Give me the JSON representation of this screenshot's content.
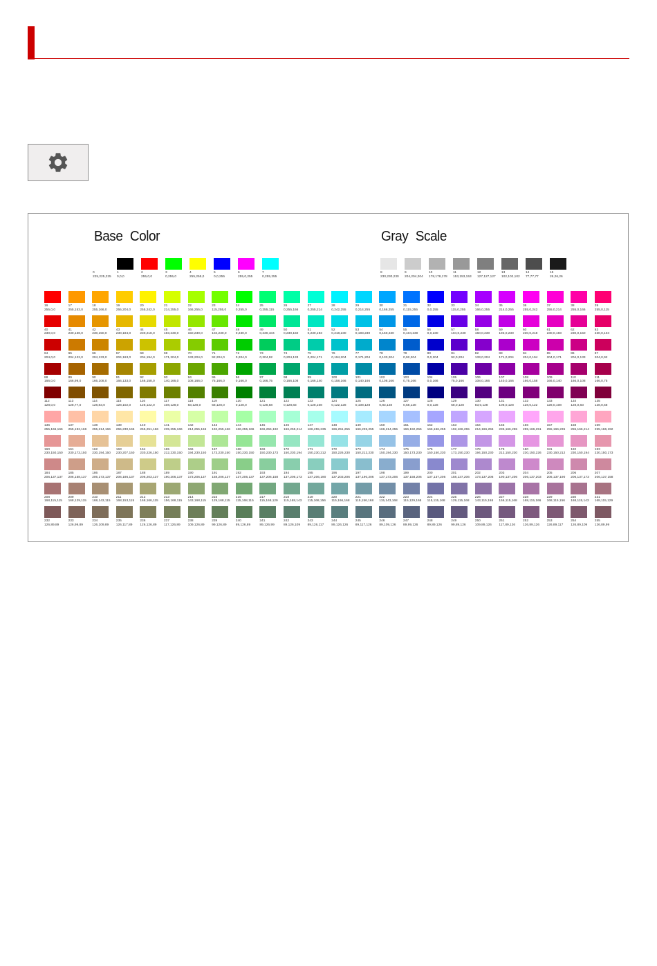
{
  "palette": {
    "base_title": "Base Color",
    "gray_title": "Gray Scale",
    "base": [
      {
        "i": 0,
        "rgb": "225,225,225"
      },
      {
        "i": 1,
        "rgb": "0,0,0"
      },
      {
        "i": 2,
        "rgb": "255,0,0"
      },
      {
        "i": 3,
        "rgb": "0,255,0"
      },
      {
        "i": 4,
        "rgb": "255,255,0"
      },
      {
        "i": 5,
        "rgb": "0,0,255"
      },
      {
        "i": 6,
        "rgb": "255,0,255"
      },
      {
        "i": 7,
        "rgb": "0,255,255"
      }
    ],
    "gray": [
      {
        "i": 8,
        "rgb": "230,230,230"
      },
      {
        "i": 9,
        "rgb": "204,204,204"
      },
      {
        "i": 10,
        "rgb": "178,178,178"
      },
      {
        "i": 11,
        "rgb": "153,153,153"
      },
      {
        "i": 12,
        "rgb": "127,127,127"
      },
      {
        "i": 13,
        "rgb": "102,102,102"
      },
      {
        "i": 14,
        "rgb": "77,77,77"
      },
      {
        "i": 15,
        "rgb": "26,26,26"
      }
    ],
    "rows": [
      [
        "255,0,0",
        "255,153,0",
        "255,166,0",
        "255,204,0",
        "255,242,0",
        "214,255,0",
        "166,255,0",
        "115,255,0",
        "0,255,0",
        "0,255,115",
        "0,255,166",
        "0,255,214",
        "0,242,255",
        "0,214,255",
        "0,166,255",
        "0,115,255",
        "0,0,255",
        "115,0,255",
        "166,0,255",
        "214,0,255",
        "255,0,242",
        "255,0,214",
        "255,0,166",
        "255,0,115"
      ],
      [
        "230,0,0",
        "230,138,0",
        "230,150,0",
        "230,184,0",
        "230,218,0",
        "193,230,0",
        "150,230,0",
        "104,230,0",
        "0,230,0",
        "0,230,104",
        "0,230,150",
        "0,230,193",
        "0,218,230",
        "0,193,230",
        "0,150,230",
        "0,104,230",
        "0,0,230",
        "104,0,230",
        "150,0,230",
        "193,0,230",
        "230,0,218",
        "230,0,193",
        "230,0,150",
        "230,0,104"
      ],
      [
        "204,0,0",
        "204,122,0",
        "204,133,0",
        "204,163,0",
        "204,194,0",
        "171,204,0",
        "133,204,0",
        "92,204,0",
        "0,204,0",
        "0,204,92",
        "0,204,133",
        "0,204,171",
        "0,194,204",
        "0,171,204",
        "0,133,204",
        "0,92,204",
        "0,0,204",
        "92,0,204",
        "133,0,204",
        "171,0,204",
        "204,0,194",
        "204,0,171",
        "204,0,133",
        "204,0,92"
      ],
      [
        "166,0,0",
        "166,99,0",
        "166,108,0",
        "166,133,0",
        "166,158,0",
        "140,166,0",
        "108,166,0",
        "75,166,0",
        "0,166,0",
        "0,166,75",
        "0,166,108",
        "0,166,140",
        "0,158,166",
        "0,140,166",
        "0,108,166",
        "0,75,166",
        "0,0,166",
        "75,0,166",
        "108,0,166",
        "140,0,166",
        "166,0,158",
        "166,0,140",
        "166,0,108",
        "166,0,75"
      ],
      [
        "128,0,0",
        "128,77,0",
        "128,83,0",
        "128,102,0",
        "128,122,0",
        "108,128,0",
        "83,128,0",
        "58,128,0",
        "0,128,0",
        "0,128,58",
        "0,128,83",
        "0,128,108",
        "0,122,128",
        "0,108,128",
        "0,83,128",
        "0,58,128",
        "0,0,128",
        "58,0,128",
        "83,0,128",
        "108,0,128",
        "128,0,122",
        "128,0,108",
        "128,0,83",
        "128,0,58"
      ],
      [
        "255,166,166",
        "255,192,166",
        "255,214,166",
        "255,230,166",
        "255,251,166",
        "235,255,166",
        "214,255,166",
        "192,255,166",
        "166,255,166",
        "166,255,192",
        "166,255,214",
        "166,255,235",
        "166,251,255",
        "166,235,255",
        "166,214,255",
        "166,192,255",
        "166,166,255",
        "192,166,255",
        "214,166,255",
        "235,166,255",
        "255,166,251",
        "255,166,235",
        "255,166,214",
        "255,166,192"
      ],
      [
        "230,150,150",
        "230,173,150",
        "230,194,150",
        "230,207,150",
        "230,226,150",
        "212,230,150",
        "194,230,150",
        "173,230,150",
        "150,230,150",
        "150,230,173",
        "150,230,194",
        "150,230,212",
        "150,226,230",
        "150,212,230",
        "150,194,230",
        "150,173,230",
        "150,150,230",
        "173,150,230",
        "194,150,230",
        "212,150,230",
        "230,150,226",
        "230,150,212",
        "230,150,194",
        "230,150,173"
      ],
      [
        "206,137,137",
        "206,158,137",
        "206,173,137",
        "206,186,137",
        "206,203,137",
        "190,206,137",
        "173,206,137",
        "158,206,137",
        "137,206,137",
        "137,206,158",
        "137,206,173",
        "137,206,190",
        "137,203,206",
        "137,190,206",
        "137,173,206",
        "137,158,206",
        "137,137,206",
        "158,137,206",
        "173,137,206",
        "190,137,206",
        "206,137,203",
        "206,137,190",
        "206,137,173",
        "206,137,158"
      ],
      [
        "168,115,115",
        "168,129,115",
        "168,143,115",
        "168,153,115",
        "168,166,115",
        "156,168,115",
        "143,168,115",
        "129,168,115",
        "115,168,115",
        "115,168,129",
        "115,168,143",
        "115,168,156",
        "115,166,168",
        "115,156,168",
        "115,143,168",
        "115,129,168",
        "115,115,168",
        "129,115,168",
        "143,115,168",
        "156,115,168",
        "168,115,166",
        "168,115,156",
        "168,115,143",
        "168,115,129"
      ],
      [
        "126,89,89",
        "126,99,89",
        "126,109,89",
        "126,117,89",
        "126,126,89",
        "117,126,89",
        "109,126,89",
        "99,126,89",
        "89,126,89",
        "89,126,99",
        "89,126,109",
        "89,126,117",
        "89,126,126",
        "89,117,126",
        "89,109,126",
        "89,99,126",
        "89,89,126",
        "99,89,126",
        "109,89,126",
        "117,89,126",
        "126,89,126",
        "126,89,117",
        "126,89,109",
        "126,89,99"
      ]
    ]
  },
  "colors": {
    "heading_accent": "#cc0000",
    "frame_border": "#8e8e8e",
    "button_bg": "#f0eeee"
  },
  "icons": {
    "settings": "gear-icon"
  }
}
